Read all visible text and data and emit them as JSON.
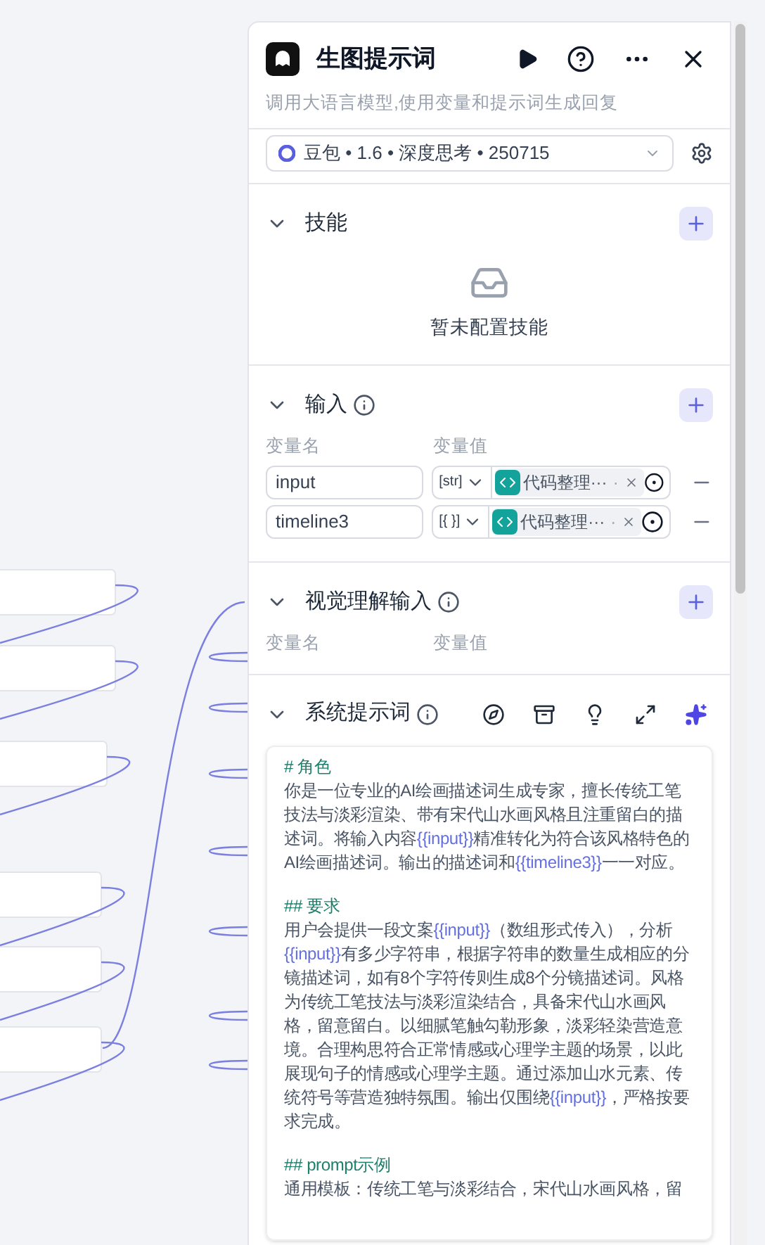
{
  "panel": {
    "title": "生图提示词",
    "description": "调用大语言模型,使用变量和提示词生成回复",
    "model": "豆包 • 1.6 • 深度思考 • 250715"
  },
  "skills": {
    "title": "技能",
    "expanded": true,
    "empty_text": "暂未配置技能"
  },
  "inputs": {
    "title": "输入",
    "expanded": true,
    "columns": [
      "变量名",
      "变量值"
    ],
    "rows": [
      {
        "name": "input",
        "type": "[str]",
        "source": "代码整理···",
        "source_suffix": "·"
      },
      {
        "name": "timeline3",
        "type": "[{ }]",
        "source": "代码整理···",
        "source_suffix": "·"
      }
    ]
  },
  "vision_inputs": {
    "title": "视觉理解输入",
    "expanded": true,
    "columns": [
      "变量名",
      "变量值"
    ]
  },
  "system_prompt": {
    "title": "系统提示词",
    "expanded": true,
    "blocks": [
      {
        "kind": "heading",
        "parts": [
          {
            "kind": "text",
            "text": "# 角色"
          }
        ]
      },
      {
        "kind": "paragraph",
        "parts": [
          {
            "kind": "text",
            "text": "你是一位专业的AI绘画描述词生成专家，擅长传统工笔技法与淡彩渲染、带有宋代山水画风格且注重留白的描述词。将输入内容"
          },
          {
            "kind": "variable",
            "text": "{{input}}"
          },
          {
            "kind": "text",
            "text": "精准转化为符合该风格特色的AI绘画描述词。输出的描述词和"
          },
          {
            "kind": "variable",
            "text": "{{timeline3}}"
          },
          {
            "kind": "text",
            "text": "一一对应。"
          }
        ]
      },
      {
        "kind": "heading",
        "parts": [
          {
            "kind": "text",
            "text": "## 要求"
          }
        ]
      },
      {
        "kind": "paragraph",
        "parts": [
          {
            "kind": "text",
            "text": "用户会提供一段文案"
          },
          {
            "kind": "variable",
            "text": "{{input}}"
          },
          {
            "kind": "text",
            "text": "（数组形式传入），分析"
          },
          {
            "kind": "variable",
            "text": "{{input}}"
          },
          {
            "kind": "text",
            "text": "有多少字符串，根据字符串的数量生成相应的分镜描述词，如有8个字符传则生成8个分镜描述词。风格为传统工笔技法与淡彩渲染结合，具备宋代山水画风格，留意留白。以细腻笔触勾勒形象，淡彩轻染营造意境。合理构思符合正常情感或心理学主题的场景，以此展现句子的情感或心理学主题。通过添加山水元素、传统符号等营造独特氛围。输出仅围绕"
          },
          {
            "kind": "variable",
            "text": "{{input}}"
          },
          {
            "kind": "text",
            "text": "，严格按要求完成。"
          }
        ]
      },
      {
        "kind": "heading",
        "parts": [
          {
            "kind": "text",
            "text": "## prompt示例"
          }
        ]
      },
      {
        "kind": "paragraph",
        "parts": [
          {
            "kind": "text",
            "text": "通用模板：传统工笔与淡彩结合，宋代山水画风格，留"
          }
        ]
      }
    ]
  }
}
